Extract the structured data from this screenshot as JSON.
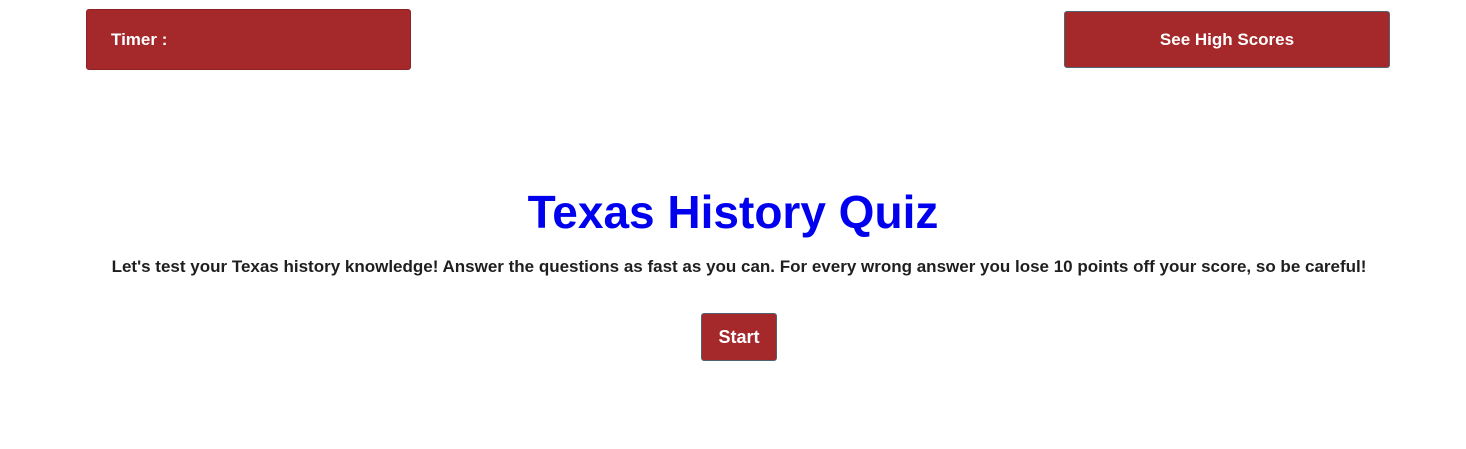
{
  "header": {
    "timer_label": "Timer :",
    "timer_value": "",
    "high_scores_label": "See High Scores"
  },
  "main": {
    "title": "Texas History Quiz",
    "intro": "Let's test your Texas history knowledge! Answer the questions as fast as you can. For every wrong answer you lose 10 points off your score, so be careful!",
    "start_label": "Start"
  },
  "colors": {
    "accent": "#a5282b",
    "title": "#0000ee",
    "text": "#1f1f1f",
    "button_border": "#4f6470"
  }
}
